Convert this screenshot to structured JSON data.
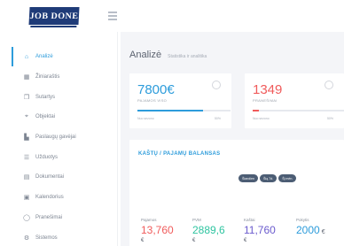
{
  "app": {
    "logo": "JOB DONE"
  },
  "sidebar": {
    "items": [
      {
        "label": "Analizė",
        "icon": "home-icon",
        "active": true
      },
      {
        "label": "Žiniaraštis",
        "icon": "grid-icon",
        "active": false
      },
      {
        "label": "Sutartys",
        "icon": "document-icon",
        "active": false
      },
      {
        "label": "Objektai",
        "icon": "location-icon",
        "active": false
      },
      {
        "label": "Paslaugų gavėjai",
        "icon": "building-icon",
        "active": false
      },
      {
        "label": "Užduotys",
        "icon": "list-icon",
        "active": false
      },
      {
        "label": "Dokumentai",
        "icon": "file-icon",
        "active": false
      },
      {
        "label": "Kalendorius",
        "icon": "calendar-icon",
        "active": false
      },
      {
        "label": "Pranešimai",
        "icon": "chat-icon",
        "active": false
      },
      {
        "label": "Sistemos",
        "icon": "gear-icon",
        "active": false
      }
    ]
  },
  "main": {
    "title": "Analizė",
    "breadcrumb": "Statistika ir analitika",
    "stats": [
      {
        "value": "7800€",
        "label": "PAJAMOS VISO",
        "footer": "Nuo sezono",
        "percent": "50%",
        "color": "#2d9cdb",
        "fill": 0.7,
        "icon": "clock-icon"
      },
      {
        "value": "1349",
        "label": "PRANEŠIMAI",
        "footer": "Nuo sezono",
        "percent": "50%",
        "color": "#f05b5b",
        "fill": 0.07,
        "icon": "chat-icon"
      }
    ],
    "balance": {
      "title": "KAŠTŲ / PAJAMŲ BALANSAS",
      "tabs": [
        "Šiandien",
        "Šią 7d.",
        "Šį mėn."
      ],
      "metrics": [
        {
          "label": "Pajamos",
          "value": "13,760",
          "currency": "€",
          "color": "#f05b5b"
        },
        {
          "label": "PVM",
          "value": "2889,6",
          "currency": "€",
          "color": "#2ec4a0"
        },
        {
          "label": "Kaštai",
          "value": "11,760",
          "currency": "€",
          "color": "#6a5acd"
        },
        {
          "label": "Pokytis",
          "value": "2000",
          "currency": "€",
          "color": "#2d9cdb"
        }
      ]
    }
  }
}
